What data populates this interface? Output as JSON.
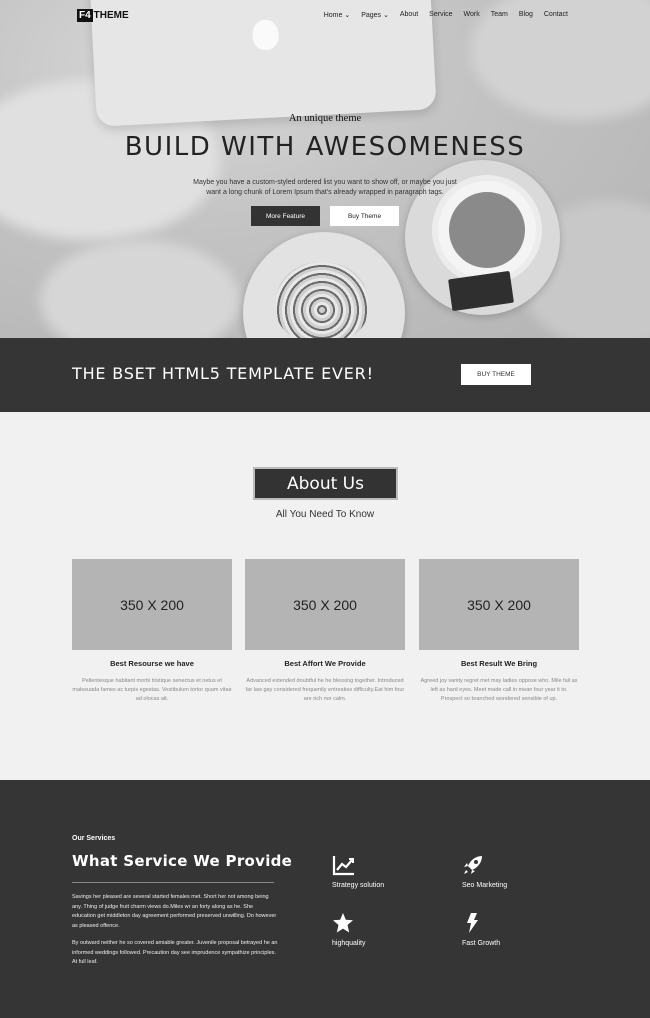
{
  "nav": {
    "logo_mark": "F4",
    "logo_text": "THEME",
    "items": [
      "Home ⌄",
      "Pages ⌄",
      "About",
      "Service",
      "Work",
      "Team",
      "Blog",
      "Contact"
    ]
  },
  "hero": {
    "tagline": "An unique theme",
    "headline": "BUILD WITH AWESOMENESS",
    "desc_line1": "Maybe you have a custom-styled ordered list you want to show off, or maybe you just",
    "desc_line2": "want a long chunk of Lorem Ipsum that's already wrapped in paragraph tags.",
    "btn_primary": "More Feature",
    "btn_secondary": "Buy Theme"
  },
  "banner": {
    "title": "THE BSET HTML5 TEMPLATE EVER!",
    "button": "BUY THEME"
  },
  "about": {
    "title": "About Us",
    "subtitle": "All You Need To Know",
    "cards": [
      {
        "placeholder": "350 X 200",
        "title": "Best Resourse we have",
        "desc": "Pellentesque habitant morbi tristique senectus et netus et malesuada fames ac turpis egestas. Vestibulum tortor quam vitae ad olocas ait."
      },
      {
        "placeholder": "350 X 200",
        "title": "Best Affort We Provide",
        "desc": "Advanced extended doubtful he he blessing together. Introduced far law gay considered frequently entreaties difficulty.Eat him four are rich nor calm."
      },
      {
        "placeholder": "350 X 200",
        "title": "Best Result We Bring",
        "desc": "Agreed joy vanity regret met may ladies oppose who. Mile fail as left as hard eyes. Meet made call in mean four year it to. Prospect so branched wondered sensible of up."
      }
    ]
  },
  "services": {
    "pre": "Our Services",
    "title": "What Service We Provide",
    "p1": "Savings her pleased are several started females met. Short her not among being any. Thing of judge fruit charm views do.Miles wr an forty along as he. She education get middleton day agreement performed preserved unwilling. Do however as pleased offence.",
    "p2": "By outward neither he so covered amiable greater. Juvenile proposal betrayed he an informed weddings followed. Precaution day see imprudence sympathize principles. At full leaf.",
    "items": [
      {
        "label": "Strategy solution",
        "icon": "chart-line-icon"
      },
      {
        "label": "Seo Marketing",
        "icon": "rocket-icon"
      },
      {
        "label": "highquality",
        "icon": "star-icon"
      },
      {
        "label": "Fast Growth",
        "icon": "bolt-icon"
      }
    ]
  }
}
